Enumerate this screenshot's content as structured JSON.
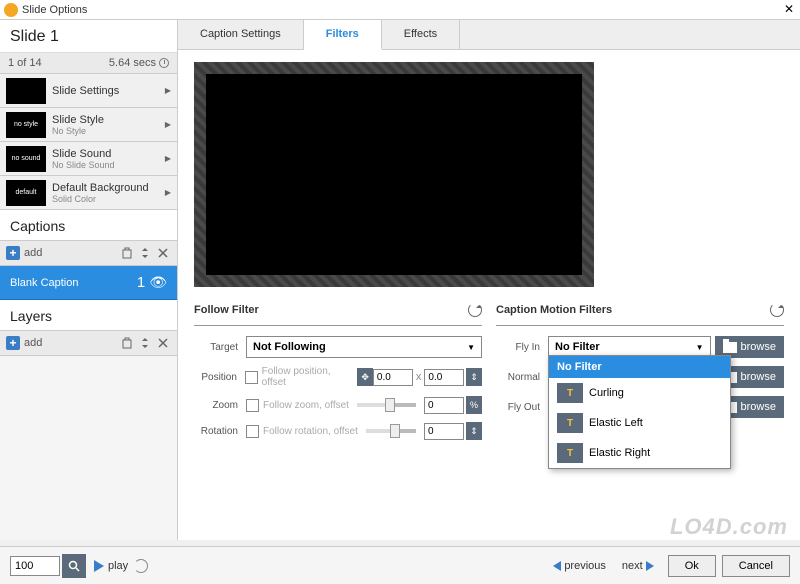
{
  "window": {
    "title": "Slide Options"
  },
  "sidebar": {
    "slide_title": "Slide 1",
    "counter": "1 of 14",
    "duration": "5.64 secs",
    "rows": [
      {
        "label": "Slide Settings",
        "sub": ""
      },
      {
        "label": "Slide Style",
        "sub": "No Style"
      },
      {
        "label": "Slide Sound",
        "sub": "No Slide Sound"
      },
      {
        "label": "Default Background",
        "sub": "Solid Color"
      }
    ],
    "captions_head": "Captions",
    "layers_head": "Layers",
    "add_label": "add",
    "caption_item": {
      "label": "Blank Caption",
      "count": "1"
    }
  },
  "tabs": [
    {
      "label": "Caption Settings",
      "active": false
    },
    {
      "label": "Filters",
      "active": true
    },
    {
      "label": "Effects",
      "active": false
    }
  ],
  "follow": {
    "title": "Follow Filter",
    "target_label": "Target",
    "target_value": "Not Following",
    "position": {
      "label": "Position",
      "text": "Follow position, offset",
      "x": "0.0",
      "y": "0.0"
    },
    "zoom": {
      "label": "Zoom",
      "text": "Follow zoom, offset",
      "value": "0"
    },
    "rotation": {
      "label": "Rotation",
      "text": "Follow rotation, offset",
      "value": "0"
    }
  },
  "motion": {
    "title": "Caption Motion Filters",
    "browse_label": "browse",
    "rows": [
      {
        "label": "Fly In",
        "value": "No Filter"
      },
      {
        "label": "Normal",
        "value": ""
      },
      {
        "label": "Fly Out",
        "value": ""
      }
    ],
    "dropdown_options": [
      {
        "label": "No Filter",
        "selected": true,
        "icon": false
      },
      {
        "label": "Curling",
        "selected": false,
        "icon": true
      },
      {
        "label": "Elastic Left",
        "selected": false,
        "icon": true
      },
      {
        "label": "Elastic Right",
        "selected": false,
        "icon": true
      }
    ]
  },
  "bottom": {
    "zoom": "100",
    "play": "play",
    "previous": "previous",
    "next": "next",
    "ok": "Ok",
    "cancel": "Cancel"
  },
  "watermark": "LO4D.com"
}
